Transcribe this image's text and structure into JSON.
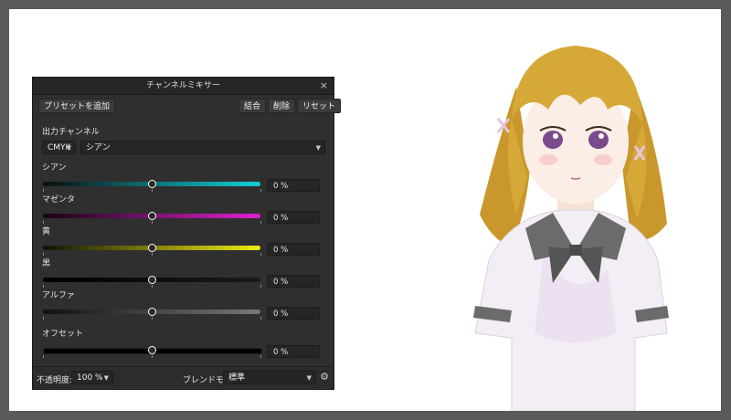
{
  "panel": {
    "title": "チャンネルミキサー",
    "close_icon": "×",
    "toolbar": {
      "add_preset": "プリセットを追加",
      "combine": "結合",
      "delete": "削除",
      "reset": "リセット"
    },
    "output_channel_label": "出力チャンネル",
    "color_mode": "CMYK",
    "channel": "シアン",
    "sliders": [
      {
        "label": "シアン",
        "value": "0 %",
        "level": 0.5,
        "gradient": [
          "#0b0f10",
          "#0fd0d8"
        ]
      },
      {
        "label": "マゼンタ",
        "value": "0 %",
        "level": 0.5,
        "gradient": [
          "#14050f",
          "#e020d0"
        ]
      },
      {
        "label": "黄",
        "value": "0 %",
        "level": 0.5,
        "gradient": [
          "#111109",
          "#eeee10"
        ]
      },
      {
        "label": "黒",
        "value": "0 %",
        "level": 0.5,
        "gradient": [
          "#000000",
          "#1a1a1a"
        ]
      },
      {
        "label": "アルファ",
        "value": "0 %",
        "level": 0.5,
        "gradient": [
          "#111111",
          "#777777"
        ]
      },
      {
        "label": "オフセット",
        "value": "0 %",
        "level": 0.5,
        "gradient": [
          "#000000",
          "#000000"
        ]
      }
    ],
    "footer": {
      "opacity_label": "不透明度:",
      "opacity_value": "100 %",
      "blend_label": "ブレンドモード:",
      "blend_value": "標準",
      "gear_icon": "gear-icon"
    }
  },
  "colors": {
    "background": "#5a5a5a",
    "canvas": "#ffffff",
    "panel_bg": "#2f2f2f",
    "hair": "#d6a838",
    "eyes": "#7a4a8c",
    "uniform_trim": "#6b6b6b"
  }
}
